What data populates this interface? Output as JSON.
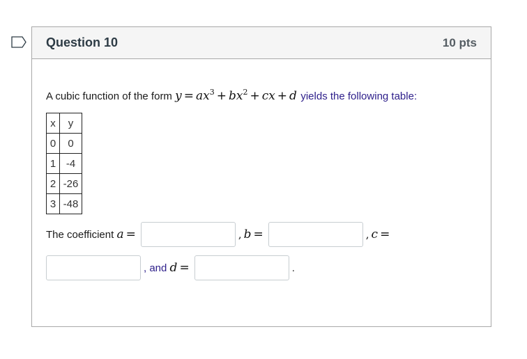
{
  "question": {
    "title": "Question 10",
    "points": "10 pts",
    "flag_icon": "bookmark-flag-icon",
    "intro_text": "A cubic function of the form",
    "equation": {
      "lhs": "y",
      "eq": "=",
      "t1": "ax",
      "t1_exp": "3",
      "plus1": "+",
      "t2": "bx",
      "t2_exp": "2",
      "plus2": "+",
      "t3": "cx",
      "plus3": "+",
      "t4": "d"
    },
    "intro_suffix": "yields the following table:",
    "table": {
      "headers": [
        "x",
        "y"
      ],
      "rows": [
        [
          "0",
          "0"
        ],
        [
          "1",
          "-4"
        ],
        [
          "2",
          "-26"
        ],
        [
          "3",
          "-48"
        ]
      ]
    },
    "answer_prompt": "The coefficient",
    "answers": [
      {
        "var": "a",
        "eq": "=",
        "value": "",
        "prefix": ""
      },
      {
        "var": "b",
        "eq": "=",
        "value": "",
        "prefix": ","
      },
      {
        "var": "c",
        "eq": "=",
        "value": "",
        "prefix": ","
      },
      {
        "var": "d",
        "eq": "=",
        "value": "",
        "prefix": ", and"
      }
    ],
    "period": "."
  }
}
